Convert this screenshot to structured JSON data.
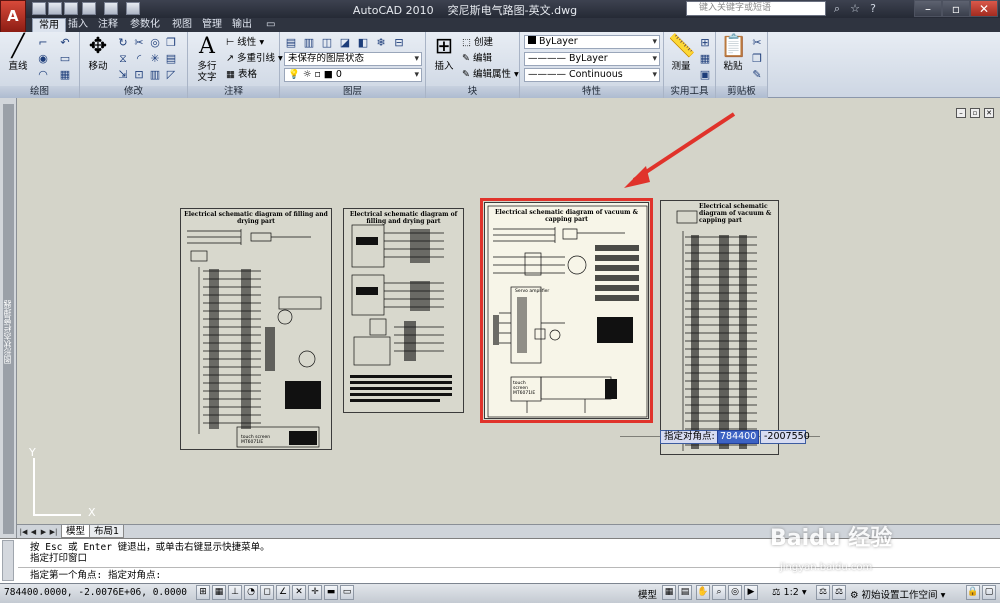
{
  "app": {
    "title": "AutoCAD 2010",
    "document": "突尼斯电气路图-英文.dwg",
    "search_placeholder": "键入关键字或短语",
    "app_button": "A",
    "accent": "#d74a3a"
  },
  "tabs": [
    "常用",
    "插入",
    "注释",
    "参数化",
    "视图",
    "管理",
    "输出"
  ],
  "ribbon": {
    "draw": {
      "label": "绘图",
      "line": "直线"
    },
    "modify": {
      "label": "修改",
      "move": "移动"
    },
    "annotation": {
      "label": "注释",
      "mtext": "多行\n文字",
      "linear": "线性",
      "mleader": "多重引线",
      "table": "表格"
    },
    "layers": {
      "label": "图层",
      "state": "未保存的图层状态",
      "current": "0"
    },
    "block": {
      "label": "块",
      "insert": "插入",
      "create": "创建",
      "edit": "编辑",
      "edit_attr": "编辑属性"
    },
    "properties": {
      "label": "特性",
      "color": "ByLayer",
      "linetype": "ByLayer",
      "lineweight": "Continuous"
    },
    "utilities": {
      "label": "实用工具",
      "measure": "测量"
    },
    "clipboard": {
      "label": "剪贴板",
      "paste": "粘贴"
    }
  },
  "left_palette": "图形状态栏管理器",
  "sheets": [
    {
      "title": "Electrical schematic diagram of filling and drying part",
      "screen_label": "touch screen MT6071IE"
    },
    {
      "title": "Electrical schematic diagram of filling and drying part"
    },
    {
      "title": "Electrical schematic diagram of vacuum & capping part",
      "servo": "Servo amplifier",
      "screen_label": "touch screen MT6071IE"
    },
    {
      "title": "Electrical schematic diagram of vacuum & capping part"
    }
  ],
  "coord_prompt": {
    "label": "指定对角点:",
    "x": "784400",
    "y": "-2007550"
  },
  "axes": {
    "y": "Y",
    "x": "X"
  },
  "layout_tabs": [
    "模型",
    "布局1"
  ],
  "command": {
    "lines": [
      "按 Esc 或 Enter 键退出，或单击右键显示快捷菜单。",
      "指定打印窗口"
    ],
    "prompt": "指定第一个角点: 指定对角点:"
  },
  "status": {
    "coords": "784400.0000, -2.0076E+06, 0.0000",
    "model": "模型",
    "scale": "1:2",
    "workspace": "初始设置工作空间"
  },
  "watermark": {
    "brand": "Baidu 经验",
    "url": "jingyan.baidu.com"
  }
}
